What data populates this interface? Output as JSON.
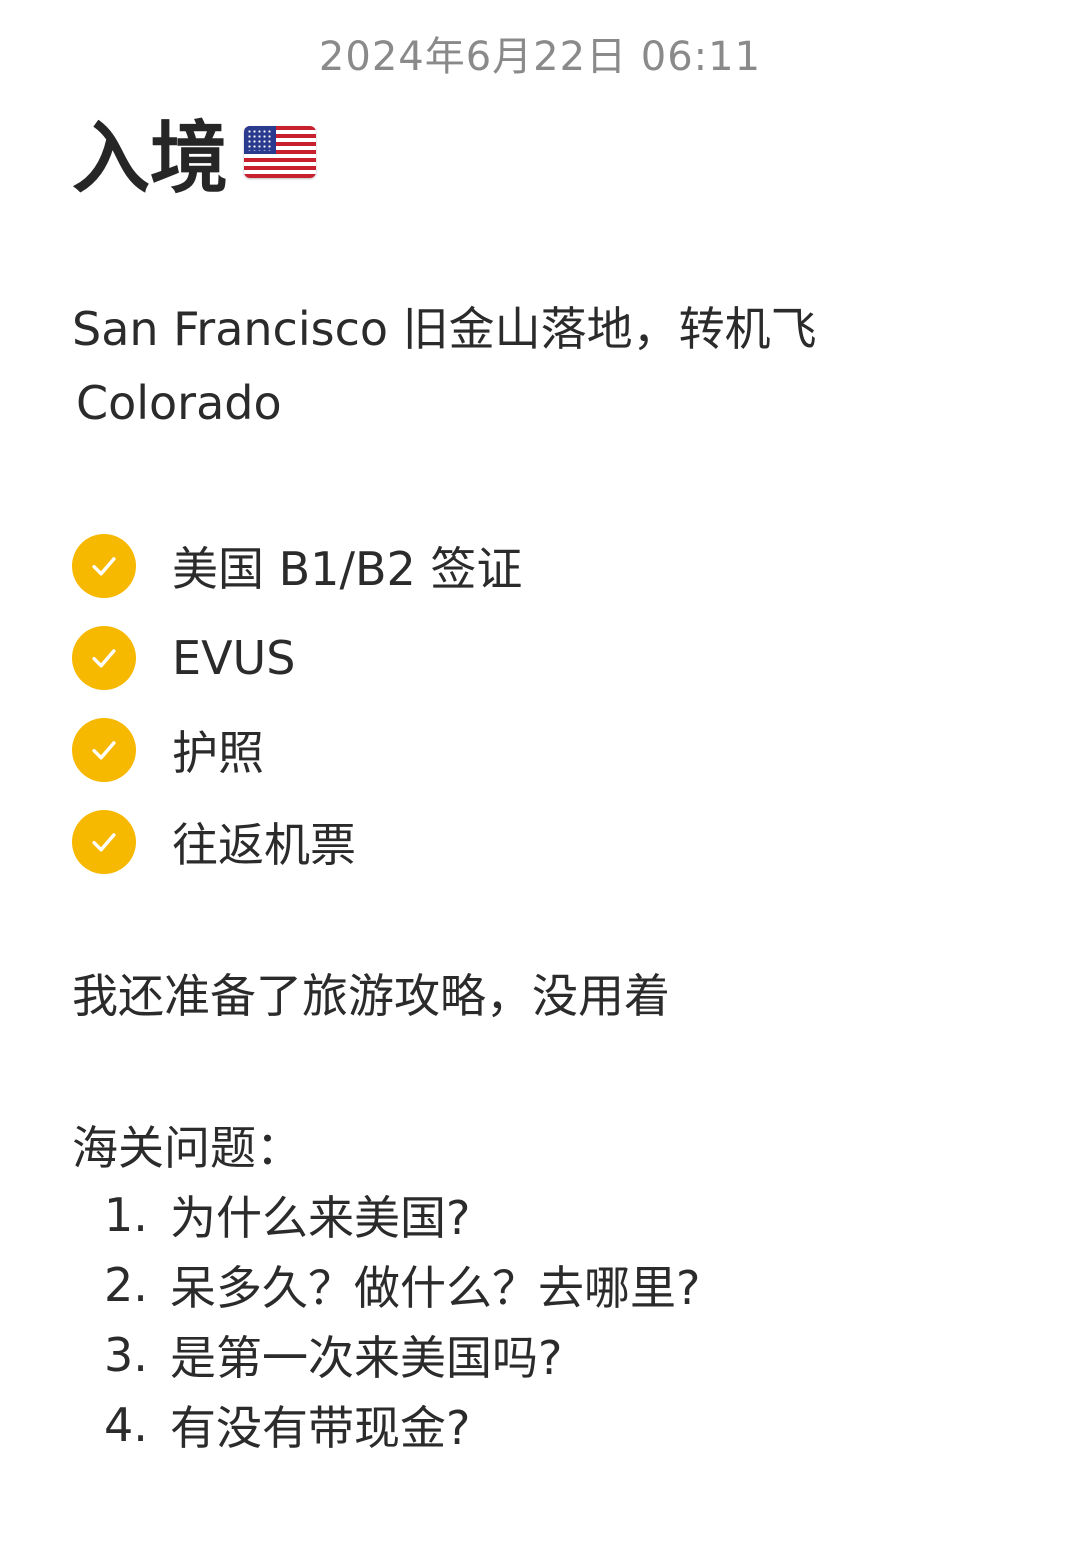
{
  "note": {
    "timestamp": "2024年6月22日 06:11",
    "title": "入境",
    "title_icon": "us-flag-icon",
    "intro_line1": "San Francisco 旧金山落地，转机飞",
    "intro_line2": "Colorado",
    "checklist": [
      {
        "label": "美国 B1/B2 签证",
        "checked": true
      },
      {
        "label": "EVUS",
        "checked": true
      },
      {
        "label": "护照",
        "checked": true
      },
      {
        "label": "往返机票",
        "checked": true
      }
    ],
    "remark": "我还准备了旅游攻略，没用着",
    "questions_heading": "海关问题：",
    "questions": [
      {
        "num": "1.",
        "text": "为什么来美国?"
      },
      {
        "num": "2.",
        "text": "呆多久？做什么？去哪里?"
      },
      {
        "num": "3.",
        "text": "是第一次来美国吗?"
      },
      {
        "num": "4.",
        "text": "有没有带现金?"
      }
    ]
  },
  "colors": {
    "check_accent": "#f7b800",
    "timestamp_text": "#8a8a8a",
    "body_text": "#2b2b2b"
  }
}
